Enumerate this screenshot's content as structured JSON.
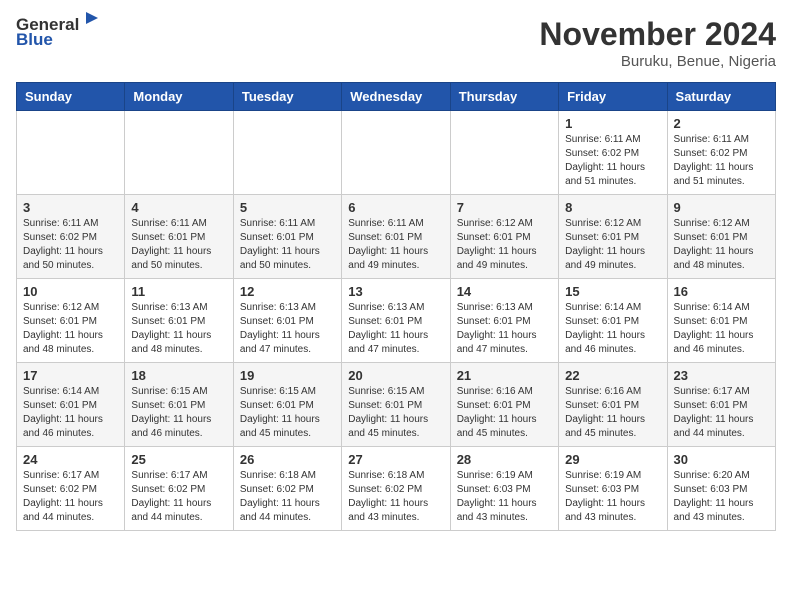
{
  "header": {
    "logo_general": "General",
    "logo_blue": "Blue",
    "month": "November 2024",
    "location": "Buruku, Benue, Nigeria"
  },
  "weekdays": [
    "Sunday",
    "Monday",
    "Tuesday",
    "Wednesday",
    "Thursday",
    "Friday",
    "Saturday"
  ],
  "weeks": [
    [
      {
        "day": "",
        "info": ""
      },
      {
        "day": "",
        "info": ""
      },
      {
        "day": "",
        "info": ""
      },
      {
        "day": "",
        "info": ""
      },
      {
        "day": "",
        "info": ""
      },
      {
        "day": "1",
        "info": "Sunrise: 6:11 AM\nSunset: 6:02 PM\nDaylight: 11 hours\nand 51 minutes."
      },
      {
        "day": "2",
        "info": "Sunrise: 6:11 AM\nSunset: 6:02 PM\nDaylight: 11 hours\nand 51 minutes."
      }
    ],
    [
      {
        "day": "3",
        "info": "Sunrise: 6:11 AM\nSunset: 6:02 PM\nDaylight: 11 hours\nand 50 minutes."
      },
      {
        "day": "4",
        "info": "Sunrise: 6:11 AM\nSunset: 6:01 PM\nDaylight: 11 hours\nand 50 minutes."
      },
      {
        "day": "5",
        "info": "Sunrise: 6:11 AM\nSunset: 6:01 PM\nDaylight: 11 hours\nand 50 minutes."
      },
      {
        "day": "6",
        "info": "Sunrise: 6:11 AM\nSunset: 6:01 PM\nDaylight: 11 hours\nand 49 minutes."
      },
      {
        "day": "7",
        "info": "Sunrise: 6:12 AM\nSunset: 6:01 PM\nDaylight: 11 hours\nand 49 minutes."
      },
      {
        "day": "8",
        "info": "Sunrise: 6:12 AM\nSunset: 6:01 PM\nDaylight: 11 hours\nand 49 minutes."
      },
      {
        "day": "9",
        "info": "Sunrise: 6:12 AM\nSunset: 6:01 PM\nDaylight: 11 hours\nand 48 minutes."
      }
    ],
    [
      {
        "day": "10",
        "info": "Sunrise: 6:12 AM\nSunset: 6:01 PM\nDaylight: 11 hours\nand 48 minutes."
      },
      {
        "day": "11",
        "info": "Sunrise: 6:13 AM\nSunset: 6:01 PM\nDaylight: 11 hours\nand 48 minutes."
      },
      {
        "day": "12",
        "info": "Sunrise: 6:13 AM\nSunset: 6:01 PM\nDaylight: 11 hours\nand 47 minutes."
      },
      {
        "day": "13",
        "info": "Sunrise: 6:13 AM\nSunset: 6:01 PM\nDaylight: 11 hours\nand 47 minutes."
      },
      {
        "day": "14",
        "info": "Sunrise: 6:13 AM\nSunset: 6:01 PM\nDaylight: 11 hours\nand 47 minutes."
      },
      {
        "day": "15",
        "info": "Sunrise: 6:14 AM\nSunset: 6:01 PM\nDaylight: 11 hours\nand 46 minutes."
      },
      {
        "day": "16",
        "info": "Sunrise: 6:14 AM\nSunset: 6:01 PM\nDaylight: 11 hours\nand 46 minutes."
      }
    ],
    [
      {
        "day": "17",
        "info": "Sunrise: 6:14 AM\nSunset: 6:01 PM\nDaylight: 11 hours\nand 46 minutes."
      },
      {
        "day": "18",
        "info": "Sunrise: 6:15 AM\nSunset: 6:01 PM\nDaylight: 11 hours\nand 46 minutes."
      },
      {
        "day": "19",
        "info": "Sunrise: 6:15 AM\nSunset: 6:01 PM\nDaylight: 11 hours\nand 45 minutes."
      },
      {
        "day": "20",
        "info": "Sunrise: 6:15 AM\nSunset: 6:01 PM\nDaylight: 11 hours\nand 45 minutes."
      },
      {
        "day": "21",
        "info": "Sunrise: 6:16 AM\nSunset: 6:01 PM\nDaylight: 11 hours\nand 45 minutes."
      },
      {
        "day": "22",
        "info": "Sunrise: 6:16 AM\nSunset: 6:01 PM\nDaylight: 11 hours\nand 45 minutes."
      },
      {
        "day": "23",
        "info": "Sunrise: 6:17 AM\nSunset: 6:01 PM\nDaylight: 11 hours\nand 44 minutes."
      }
    ],
    [
      {
        "day": "24",
        "info": "Sunrise: 6:17 AM\nSunset: 6:02 PM\nDaylight: 11 hours\nand 44 minutes."
      },
      {
        "day": "25",
        "info": "Sunrise: 6:17 AM\nSunset: 6:02 PM\nDaylight: 11 hours\nand 44 minutes."
      },
      {
        "day": "26",
        "info": "Sunrise: 6:18 AM\nSunset: 6:02 PM\nDaylight: 11 hours\nand 44 minutes."
      },
      {
        "day": "27",
        "info": "Sunrise: 6:18 AM\nSunset: 6:02 PM\nDaylight: 11 hours\nand 43 minutes."
      },
      {
        "day": "28",
        "info": "Sunrise: 6:19 AM\nSunset: 6:03 PM\nDaylight: 11 hours\nand 43 minutes."
      },
      {
        "day": "29",
        "info": "Sunrise: 6:19 AM\nSunset: 6:03 PM\nDaylight: 11 hours\nand 43 minutes."
      },
      {
        "day": "30",
        "info": "Sunrise: 6:20 AM\nSunset: 6:03 PM\nDaylight: 11 hours\nand 43 minutes."
      }
    ]
  ]
}
